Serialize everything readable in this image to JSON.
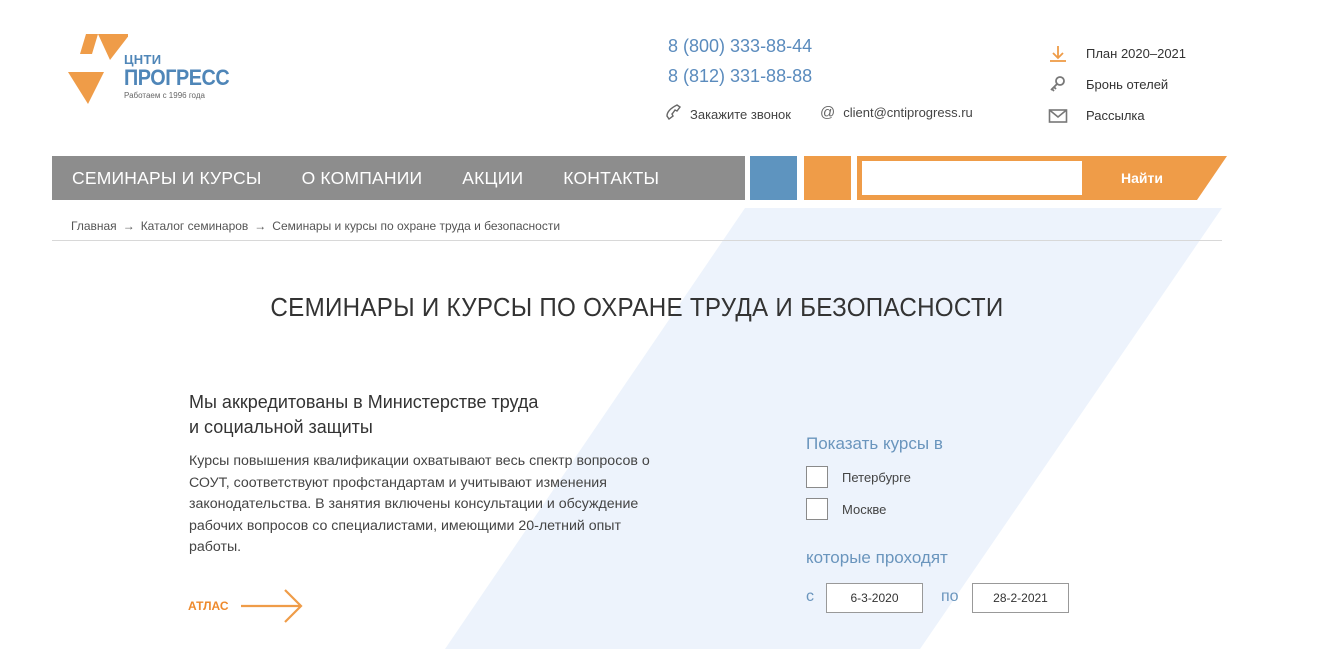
{
  "header": {
    "logo": {
      "top_text": "ЦНТИ",
      "main_text": "ПРОГРЕСС",
      "tagline": "Работаем с 1996 года"
    },
    "phones": [
      "8 (800) 333-88-44",
      "8 (812) 331-88-88"
    ],
    "callback_label": "Закажите звонок",
    "email": "client@cntiprogress.ru",
    "side_links": [
      {
        "label": "План 2020–2021",
        "icon": "download-icon"
      },
      {
        "label": "Бронь отелей",
        "icon": "key-icon"
      },
      {
        "label": "Рассылка",
        "icon": "envelope-icon"
      }
    ]
  },
  "nav": {
    "items": [
      "СЕМИНАРЫ И КУРСЫ",
      "О КОМПАНИИ",
      "АКЦИИ",
      "КОНТАКТЫ"
    ],
    "search_placeholder": "",
    "search_button": "Найти"
  },
  "breadcrumb": [
    "Главная",
    "Каталог семинаров",
    "Семинары и курсы по охране труда и безопасности"
  ],
  "breadcrumb_separator": "→",
  "page_title": "СЕМИНАРЫ И КУРСЫ ПО ОХРАНЕ ТРУДА И БЕЗОПАСНОСТИ",
  "intro": {
    "heading_line1": "Мы аккредитованы в Министерстве труда",
    "heading_line2": "и социальной защиты",
    "text": "Курсы повышения квалификации охватывают весь спектр вопросов о СОУТ, соответствуют профстандартам и учитывают изменения законодательства. В занятия включены консультации и обсуждение рабочих вопросов со специалистами, имеющими 20-летний опыт работы.",
    "atlas_label": "АТЛАС"
  },
  "filter": {
    "show_label": "Показать курсы в",
    "cities": [
      "Петербурге",
      "Москве"
    ],
    "city_checked": [
      false,
      false
    ],
    "period_label": "которые проходят",
    "from_label": "с",
    "to_label": "по",
    "date_from": "6-3-2020",
    "date_to": "28-2-2021"
  },
  "colors": {
    "orange": "#ef9c48",
    "blue": "#5e94bf",
    "nav_gray": "#8d8d8d",
    "bg_shape": "#edf3fc"
  }
}
